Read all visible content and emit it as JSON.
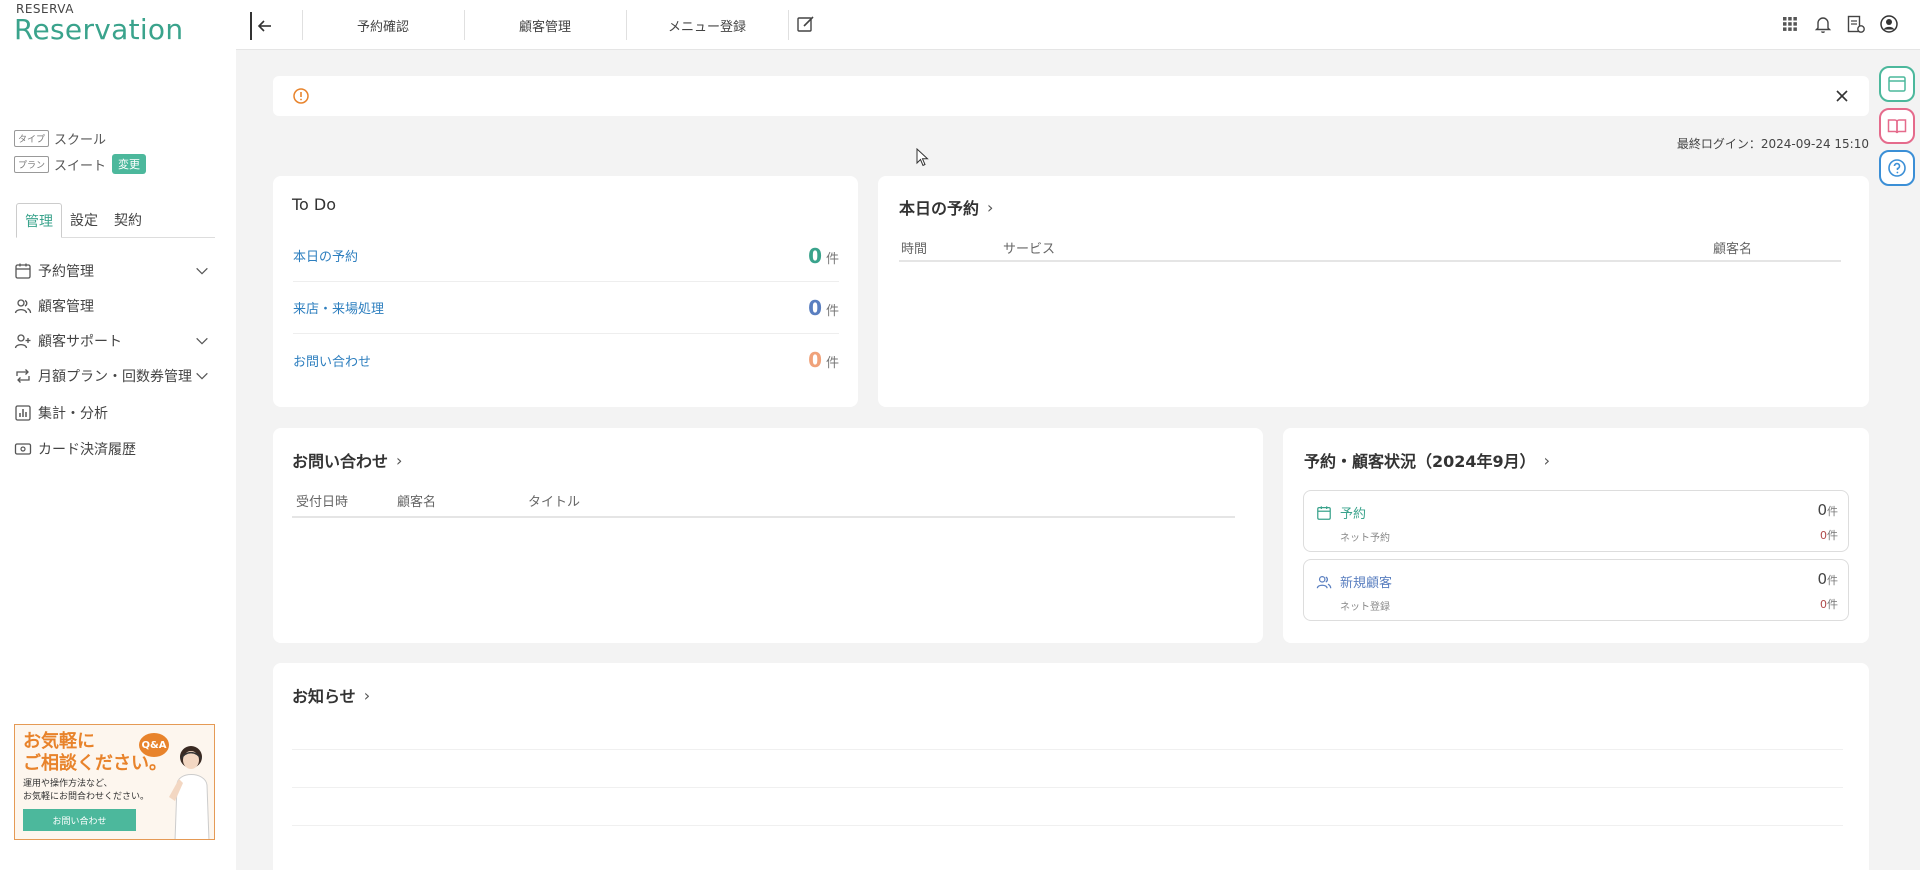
{
  "app": {
    "brand_small": "RESERVA",
    "brand_big": "Reservation"
  },
  "sidebar": {
    "type_tag": "タイプ",
    "type_value": "スクール",
    "plan_tag": "プラン",
    "plan_value": "スイート",
    "change_label": "変更",
    "tabs": [
      {
        "label": "管理"
      },
      {
        "label": "設定"
      },
      {
        "label": "契約"
      }
    ],
    "items": [
      {
        "label": "予約管理"
      },
      {
        "label": "顧客管理"
      },
      {
        "label": "顧客サポート"
      },
      {
        "label": "月額プラン・回数券管理"
      },
      {
        "label": "集計・分析"
      },
      {
        "label": "カード決済履歴"
      }
    ],
    "banner": {
      "line1": "お気軽に",
      "line2": "ご相談ください。",
      "desc1": "運用や操作方法など、",
      "desc2": "お気軽にお問合わせください。",
      "qa": "Q&A",
      "button": "お問い合わせ"
    }
  },
  "header": {
    "links": [
      "予約確認",
      "顧客管理",
      "メニュー登録"
    ]
  },
  "last_login": "最終ログイン：2024-09-24 15:10",
  "todo": {
    "title": "To Do",
    "rows": [
      {
        "label": "本日の予約",
        "count": "0",
        "unit": "件",
        "color": "#3aa38c"
      },
      {
        "label": "来店・来場処理",
        "count": "0",
        "unit": "件",
        "color": "#5a7fc0"
      },
      {
        "label": "お問い合わせ",
        "count": "0",
        "unit": "件",
        "color": "#f0a27a"
      }
    ]
  },
  "today": {
    "title": "本日の予約",
    "cols": [
      "時間",
      "サービス",
      "顧客名"
    ]
  },
  "inquiry": {
    "title": "お問い合わせ",
    "cols": [
      "受付日時",
      "顧客名",
      "タイトル"
    ]
  },
  "status": {
    "title": "予約・顧客状況（2024年9月）",
    "boxes": [
      {
        "label": "予約",
        "sub": "ネット予約",
        "v1": "0",
        "v2": "0",
        "unit": "件"
      },
      {
        "label": "新規顧客",
        "sub": "ネット登録",
        "v1": "0",
        "v2": "0",
        "unit": "件"
      }
    ]
  },
  "notice": {
    "title": "お知らせ"
  },
  "colors": {
    "accent": "#3aa38c",
    "link": "#2e7fbf",
    "alert": "#e8832b"
  }
}
